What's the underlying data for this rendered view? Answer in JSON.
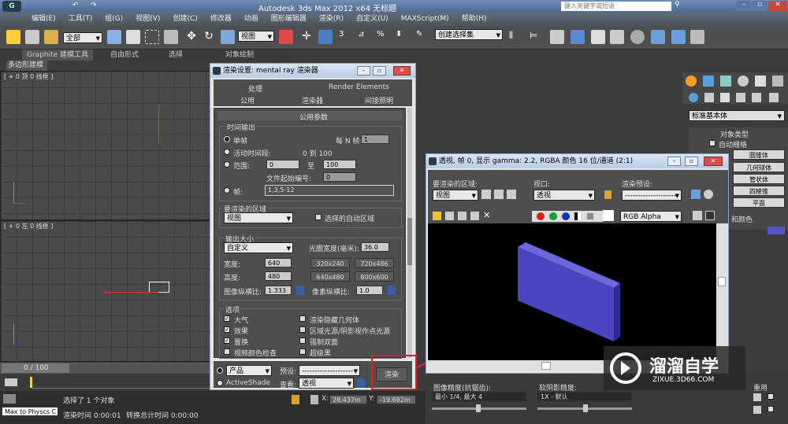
{
  "window": {
    "title": "Autodesk 3ds Max  2012 x64      无标题",
    "search_placeholder": "键入关键字或短语"
  },
  "menu": [
    "编辑(E)",
    "工具(T)",
    "组(G)",
    "视图(V)",
    "创建(C)",
    "修改器",
    "动画",
    "图形编辑器",
    "渲染(R)",
    "自定义(U)",
    "MAXScript(M)",
    "帮助(H)"
  ],
  "toolbar": {
    "filter": "全部",
    "coord": "视图",
    "named_sel": "创建选择集"
  },
  "ribbon": {
    "tabs": [
      "Graphite 建模工具",
      "自由形式",
      "选择",
      "对象绘制"
    ],
    "sub": "多边形建模"
  },
  "viewports": {
    "top": "[ + 0 顶 0 线框 ]",
    "left": "[ + 0 左 0 线框 ]"
  },
  "command_panel": {
    "dropdown": "标准基本体",
    "rollout": "对象类型",
    "auto_grid": "自动栅格",
    "items": [
      "圆锥体",
      "几何球体",
      "管状体",
      "四棱锥",
      "平面"
    ],
    "name_color": "和颜色"
  },
  "render_setup": {
    "title": "渲染设置: mental ray 渲染器",
    "tabs_row1": [
      "处理",
      "Render Elements"
    ],
    "tabs_row2": [
      "公用",
      "渲染器",
      "间接照明"
    ],
    "rollout": "公用参数",
    "time_output": {
      "group": "时间输出",
      "single": "单帧",
      "every_n": "每 N 帧:",
      "every_n_val": "1",
      "active": "活动时间段:",
      "active_range": "0 到 100",
      "range": "范围:",
      "range_from": "0",
      "to": "至",
      "range_to": "100",
      "file_start": "文件起始编号:",
      "file_start_val": "0",
      "frames": "帧:",
      "frames_val": "1,3,5-12"
    },
    "area": {
      "group": "要渲染的区域",
      "value": "视图",
      "auto": "选择的自动区域"
    },
    "output_size": {
      "group": "输出大小",
      "preset": "自定义",
      "aperture": "光圈宽度(毫米):",
      "aperture_val": "36.0",
      "width": "宽度:",
      "width_val": "640",
      "height": "高度:",
      "height_val": "480",
      "presets": [
        "320x240",
        "720x486",
        "640x480",
        "800x600"
      ],
      "img_aspect": "图像纵横比:",
      "img_aspect_val": "1.333",
      "pix_aspect": "像素纵横比:",
      "pix_aspect_val": "1.0"
    },
    "options": {
      "group": "选项",
      "items": [
        {
          "label": "大气",
          "checked": true
        },
        {
          "label": "渲染隐藏几何体",
          "checked": false
        },
        {
          "label": "效果",
          "checked": true
        },
        {
          "label": "区域光源/阴影视作点光源",
          "checked": false
        },
        {
          "label": "置换",
          "checked": true
        },
        {
          "label": "强制双面",
          "checked": false
        },
        {
          "label": "视频颜色检查",
          "checked": false
        },
        {
          "label": "超级黑",
          "checked": false
        }
      ]
    },
    "bottom": {
      "product": "产品",
      "activeshade": "ActiveShade",
      "preset_label": "预设:",
      "preset_val": "--------------------",
      "view_label": "查看:",
      "view_val": "透视",
      "render_btn": "渲染"
    }
  },
  "frame_window": {
    "title": "透视, 帧 0, 显示 gamma: 2.2, RGBA 颜色 16 位/通道 (2:1)",
    "area_label": "要渲染的区域:",
    "area_val": "视图",
    "viewport_label": "视口:",
    "viewport_val": "透视",
    "preset_label": "渲染预设:",
    "preset_val": "--------------------",
    "channel": "RGB Alpha"
  },
  "bottom_panel": {
    "img_precision": "图像精度(抗锯齿):",
    "img_val": "最小 1/4, 最大 4",
    "soft_shadow": "软阴影精度:",
    "soft_val": "1X - 默认",
    "reuse": "重用"
  },
  "timeline": {
    "frame": "0 / 100"
  },
  "status": {
    "selected": "选择了 1 个对象",
    "script": "Max to Physcs C",
    "render_time": "渲染时间  0:00:01",
    "translate_time": "转换总计时间  0:00:00",
    "x_val": "28.437m",
    "y_val": "-19.692m"
  },
  "watermark": {
    "name": "溜溜自学",
    "url": "ZIXUE.3D66.COM"
  }
}
